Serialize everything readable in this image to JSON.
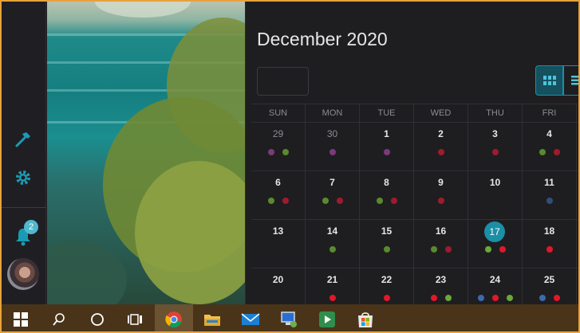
{
  "calendar": {
    "title": "December 2020",
    "weekdays": [
      "SUN",
      "MON",
      "TUE",
      "WED",
      "THU",
      "FRI"
    ],
    "weeks": [
      [
        {
          "day": "29",
          "muted": true,
          "dots": [
            "#7b3a7a",
            "#5a8a2e"
          ]
        },
        {
          "day": "30",
          "muted": true,
          "dots": [
            "#7b3a7a"
          ]
        },
        {
          "day": "1",
          "dots": [
            "#7b3a7a"
          ]
        },
        {
          "day": "2",
          "dots": [
            "#a01a2e"
          ]
        },
        {
          "day": "3",
          "dots": [
            "#a01a2e"
          ]
        },
        {
          "day": "4",
          "dots": [
            "#5a8a2e",
            "#a01a2e"
          ]
        }
      ],
      [
        {
          "day": "6",
          "dots": [
            "#5a8a2e",
            "#a01a2e"
          ]
        },
        {
          "day": "7",
          "dots": [
            "#5a8a2e",
            "#a01a2e"
          ]
        },
        {
          "day": "8",
          "dots": [
            "#5a8a2e",
            "#a01a2e"
          ]
        },
        {
          "day": "9",
          "dots": [
            "#a01a2e"
          ]
        },
        {
          "day": "10",
          "dots": []
        },
        {
          "day": "11",
          "dots": [
            "#2f4f7a"
          ]
        }
      ],
      [
        {
          "day": "13",
          "dots": []
        },
        {
          "day": "14",
          "dots": [
            "#5a8a2e"
          ]
        },
        {
          "day": "15",
          "dots": [
            "#5a8a2e"
          ]
        },
        {
          "day": "16",
          "dots": [
            "#5a8a2e",
            "#a01a2e"
          ]
        },
        {
          "day": "17",
          "today": true,
          "dots": [
            "#6aa83a",
            "#e0182a"
          ]
        },
        {
          "day": "18",
          "dots": [
            "#e0182a"
          ]
        }
      ],
      [
        {
          "day": "20",
          "dots": []
        },
        {
          "day": "21",
          "dots": [
            "#e0182a"
          ]
        },
        {
          "day": "22",
          "dots": [
            "#e0182a"
          ]
        },
        {
          "day": "23",
          "dots": [
            "#e0182a",
            "#6aa83a"
          ]
        },
        {
          "day": "24",
          "dots": [
            "#3a6ab0",
            "#e0182a",
            "#6aa83a"
          ]
        },
        {
          "day": "25",
          "dots": [
            "#3a6ab0",
            "#e0182a"
          ]
        }
      ]
    ]
  },
  "sidebar": {
    "notification_count": "2"
  },
  "colors": {
    "accent": "#1a8fa6",
    "taskbar": "#4a3419"
  },
  "taskbar": {
    "items": [
      "windows-start",
      "search",
      "cortana",
      "task-view",
      "chrome",
      "file-explorer",
      "mail",
      "network-computer",
      "media-app",
      "microsoft-store"
    ]
  }
}
